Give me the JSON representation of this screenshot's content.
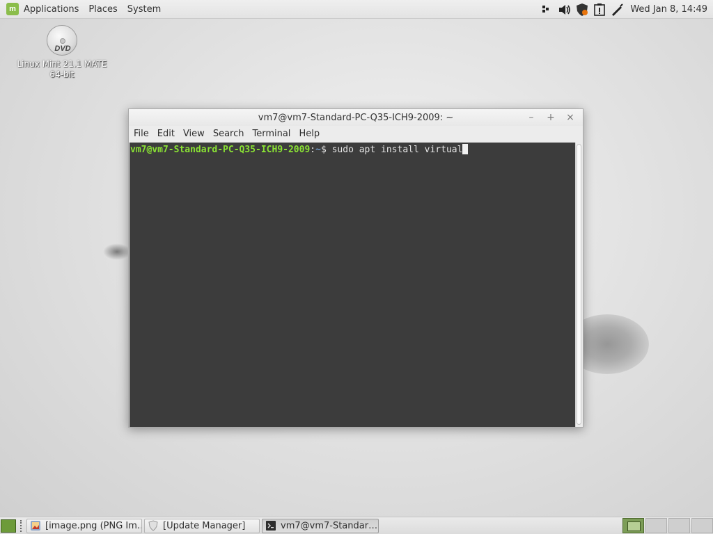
{
  "top_panel": {
    "menu": [
      "Applications",
      "Places",
      "System"
    ],
    "clock": "Wed Jan  8, 14:49",
    "tray_icons": [
      "network-icon",
      "volume-icon",
      "shield-update-icon",
      "notification-icon",
      "pen-icon"
    ]
  },
  "desktop": {
    "icons": [
      {
        "label_line1": "Linux Mint 21.1 MATE",
        "label_line2": "64-bit",
        "icon": "dvd-icon",
        "icon_text": "DVD"
      }
    ]
  },
  "terminal": {
    "title": "vm7@vm7-Standard-PC-Q35-ICH9-2009: ~",
    "controls": [
      "–",
      "+",
      "×"
    ],
    "menu": [
      "File",
      "Edit",
      "View",
      "Search",
      "Terminal",
      "Help"
    ],
    "prompt_user": "vm7@vm7-Standard-PC-Q35-ICH9-2009",
    "prompt_sep": ":",
    "prompt_path": "~",
    "prompt_symbol": "$",
    "command": "sudo apt install virtual"
  },
  "taskbar": {
    "tasks": [
      {
        "label": "[image.png (PNG Im…",
        "icon": "image-viewer-icon",
        "active": false
      },
      {
        "label": "[Update Manager]",
        "icon": "update-manager-icon",
        "active": false
      },
      {
        "label": "vm7@vm7-Standar…",
        "icon": "terminal-icon",
        "active": true
      }
    ],
    "workspaces": 4,
    "active_workspace": 1
  },
  "colors": {
    "prompt_green": "#8ae234",
    "prompt_blue": "#729fcf",
    "terminal_bg": "#3c3c3c",
    "mint_green": "#8bbd4b"
  }
}
